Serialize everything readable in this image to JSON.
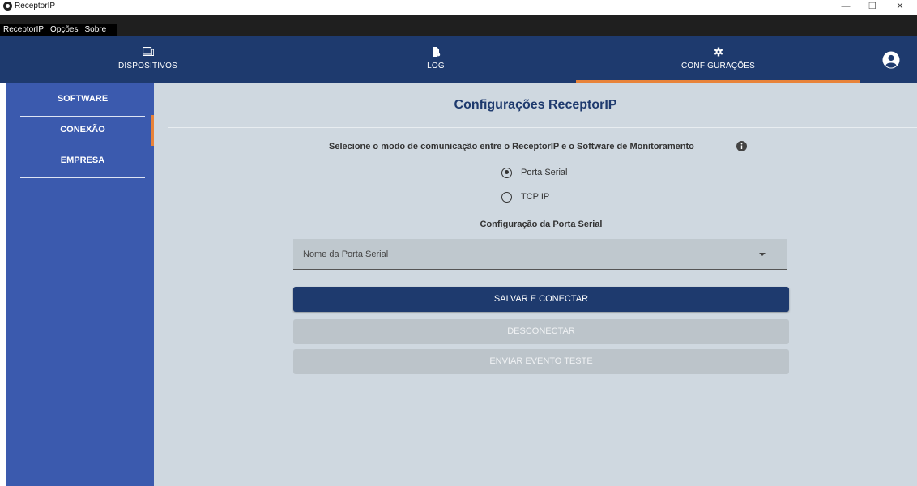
{
  "window": {
    "title": "ReceptorIP",
    "controls": {
      "minimize": "—",
      "maximize": "❐",
      "close": "✕"
    }
  },
  "menu": {
    "items": [
      "ReceptorIP",
      "Opções",
      "Sobre"
    ]
  },
  "nav": {
    "tabs": [
      {
        "label": "DISPOSITIVOS",
        "icon": "devices-icon"
      },
      {
        "label": "LOG",
        "icon": "file-log-icon"
      },
      {
        "label": "CONFIGURAÇÕES",
        "icon": "gear-icon",
        "active": true
      }
    ],
    "user_icon": "user-circle-icon"
  },
  "sidebar": {
    "items": [
      {
        "label": "SOFTWARE"
      },
      {
        "label": "CONEXÃO",
        "active": true
      },
      {
        "label": "EMPRESA"
      }
    ]
  },
  "main": {
    "title": "Configurações ReceptorIP",
    "question": "Selecione o modo de comunicação entre o ReceptorIP e o Software de Monitoramento",
    "options": [
      {
        "label": "Porta Serial",
        "checked": true
      },
      {
        "label": "TCP IP",
        "checked": false
      }
    ],
    "section_title": "Configuração da Porta Serial",
    "serial_select": {
      "placeholder": "Nome da Porta Serial"
    },
    "buttons": {
      "save": "SALVAR E CONECTAR",
      "disconnect": "DESCONECTAR",
      "test": "ENVIAR EVENTO TESTE"
    }
  },
  "colors": {
    "nav": "#1e3a6e",
    "sidebar": "#3b5aae",
    "accent": "#e8833a",
    "main_bg": "#cfd8e0"
  }
}
